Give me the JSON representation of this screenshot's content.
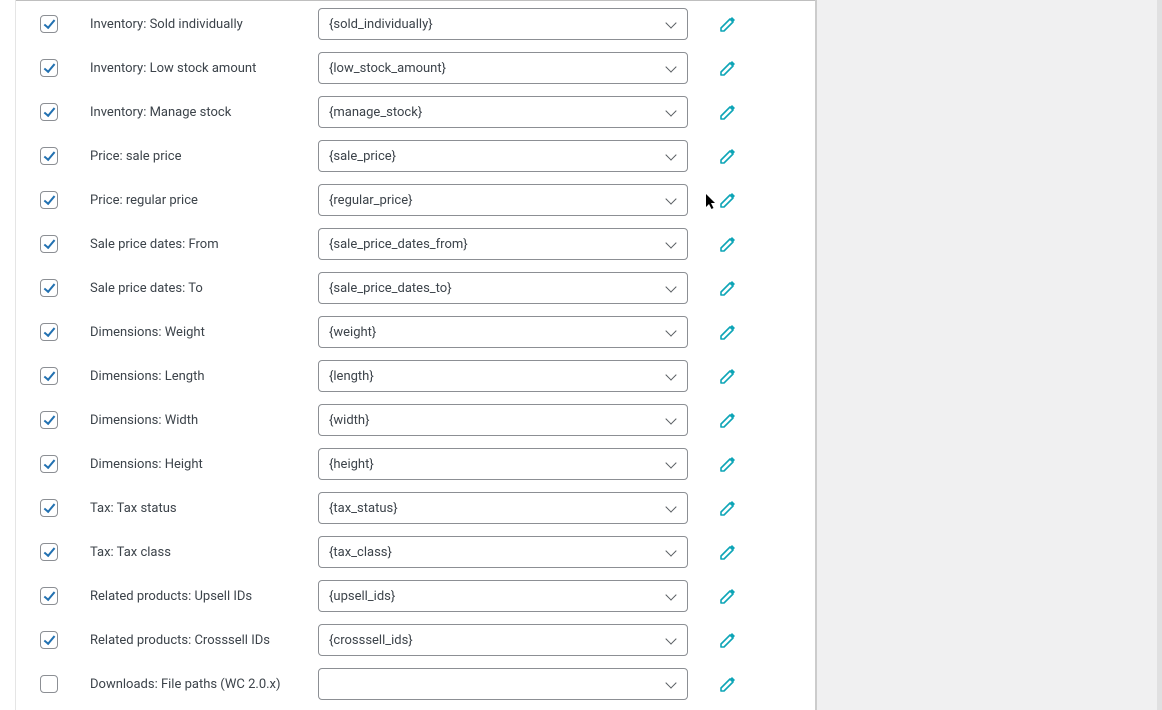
{
  "colors": {
    "accent": "#2271b1",
    "icon_teal": "#0ea5b7",
    "border": "#8c8f94"
  },
  "rows": [
    {
      "label": "Inventory: Sold individually",
      "value": "{sold_individually}",
      "checked": true
    },
    {
      "label": "Inventory: Low stock amount",
      "value": "{low_stock_amount}",
      "checked": true
    },
    {
      "label": "Inventory: Manage stock",
      "value": "{manage_stock}",
      "checked": true
    },
    {
      "label": "Price: sale price",
      "value": "{sale_price}",
      "checked": true
    },
    {
      "label": "Price: regular price",
      "value": "{regular_price}",
      "checked": true
    },
    {
      "label": "Sale price dates: From",
      "value": "{sale_price_dates_from}",
      "checked": true
    },
    {
      "label": "Sale price dates: To",
      "value": "{sale_price_dates_to}",
      "checked": true
    },
    {
      "label": "Dimensions: Weight",
      "value": "{weight}",
      "checked": true
    },
    {
      "label": "Dimensions: Length",
      "value": "{length}",
      "checked": true
    },
    {
      "label": "Dimensions: Width",
      "value": "{width}",
      "checked": true
    },
    {
      "label": "Dimensions: Height",
      "value": "{height}",
      "checked": true
    },
    {
      "label": "Tax: Tax status",
      "value": "{tax_status}",
      "checked": true
    },
    {
      "label": "Tax: Tax class",
      "value": "{tax_class}",
      "checked": true
    },
    {
      "label": "Related products: Upsell IDs",
      "value": "{upsell_ids}",
      "checked": true
    },
    {
      "label": "Related products: Crosssell IDs",
      "value": "{crosssell_ids}",
      "checked": true
    },
    {
      "label": "Downloads: File paths (WC 2.0.x)",
      "value": "",
      "checked": false
    }
  ]
}
